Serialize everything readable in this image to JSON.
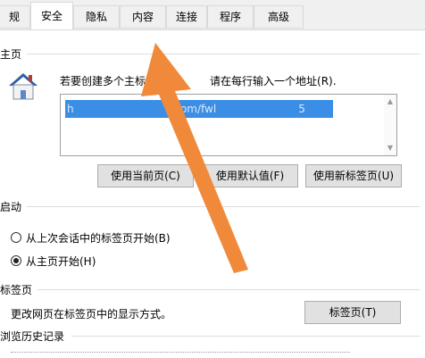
{
  "tabs": [
    {
      "label": "规"
    },
    {
      "label": "安全"
    },
    {
      "label": "隐私"
    },
    {
      "label": "内容"
    },
    {
      "label": "连接"
    },
    {
      "label": "程序"
    },
    {
      "label": "高级"
    }
  ],
  "homepage": {
    "title": "主页",
    "instruction": "若要创建多个主标",
    "instruction_tail": "请在每行输入一个地址(R).",
    "url_visible_1": "h",
    "url_visible_2": "o",
    "url_visible_3": "om/fwl",
    "url_visible_4": "5",
    "buttons": {
      "use_current": "使用当前页(C)",
      "use_default": "使用默认值(F)",
      "use_new_tab": "使用新标签页(U)"
    }
  },
  "startup": {
    "title": "启动",
    "options": [
      {
        "label": "从上次会话中的标签页开始(B)",
        "selected": false
      },
      {
        "label": "从主页开始(H)",
        "selected": true
      }
    ]
  },
  "tabs_section": {
    "title": "标签页",
    "description": "更改网页在标签页中的显示方式。",
    "button": "标签页(T)"
  },
  "history": {
    "title": "浏览历史记录"
  },
  "colors": {
    "arrow": "#f08a3a",
    "selection": "#3b8ee6"
  }
}
